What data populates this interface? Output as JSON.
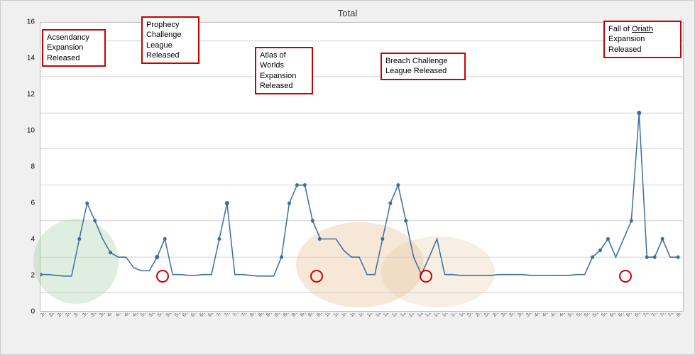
{
  "chart": {
    "title": "Total",
    "y_max": 16,
    "y_labels": [
      "0",
      "2",
      "4",
      "6",
      "8",
      "10",
      "12",
      "14",
      "16"
    ],
    "annotations": [
      {
        "id": "ascendancy",
        "text": "Acsendancy\nExpansion\nReleased",
        "lines": [
          "Acsendancy",
          "Expansion",
          "Released"
        ]
      },
      {
        "id": "prophecy",
        "text": "Prophecy\nChallenge\nLeague\nReleased",
        "lines": [
          "Prophecy",
          "Challenge",
          "League",
          "Released"
        ]
      },
      {
        "id": "atlas",
        "text": "Atlas of\nWorlds\nExpansion\nReleased",
        "lines": [
          "Atlas of",
          "Worlds",
          "Expansion",
          "Released"
        ]
      },
      {
        "id": "breach",
        "text": "Breach Challenge\nLeague Released",
        "lines": [
          "Breach Challenge",
          "League Released"
        ]
      },
      {
        "id": "oriath",
        "text": "Fall of Oriath\nExpansion\nReleased",
        "lines": [
          "Fall of Oriath",
          "Expansion",
          "Released"
        ]
      }
    ],
    "x_dates": [
      "2/1/2016",
      "2/8/2016",
      "2/15/2016",
      "2/22/2016",
      "3/7/2016",
      "3/14/2016",
      "3/21/2016",
      "3/28/2016",
      "4/4/2016",
      "4/11/2016",
      "4/18/2016",
      "4/25/2016",
      "5/2/2016",
      "5/9/2016",
      "5/16/2016",
      "5/23/2016",
      "5/31/2016",
      "6/6/2016",
      "6/13/2016",
      "6/20/2016",
      "6/27/2016",
      "7/4/2016",
      "7/11/2016",
      "7/18/2016",
      "7/25/2016",
      "8/1/2016",
      "8/8/2016",
      "8/15/2016",
      "8/22/2016",
      "8/29/2016",
      "9/5/2016",
      "9/12/2016",
      "9/19/2016",
      "9/26/2016",
      "10/3/2016",
      "10/10/2016",
      "10/17/2016",
      "10/24/2016",
      "10/31/2016",
      "11/7/2016",
      "11/14/2016",
      "11/21/2016",
      "11/28/2016",
      "12/5/2016",
      "12/12/2016",
      "12/19/2016",
      "12/26/2016",
      "1/2/2017",
      "1/9/2017",
      "1/16/2017",
      "1/23/2017",
      "2/6/2017",
      "2/13/2017",
      "2/20/2017",
      "2/27/2017",
      "3/6/2017",
      "3/13/2017",
      "3/20/2017",
      "3/27/2017",
      "4/3/2017",
      "4/10/2017",
      "4/17/2017",
      "4/24/2017",
      "5/1/2017",
      "5/8/2017",
      "5/15/2017",
      "5/22/2017",
      "5/29/2017",
      "6/5/2017",
      "6/12/2017",
      "6/19/2017",
      "6/26/2017",
      "7/3/2017",
      "7/10/2017",
      "7/17/2017",
      "7/24/2017",
      "7/31/2017",
      "8/7/2017",
      "8/14/2017",
      "8/21/2017"
    ]
  }
}
